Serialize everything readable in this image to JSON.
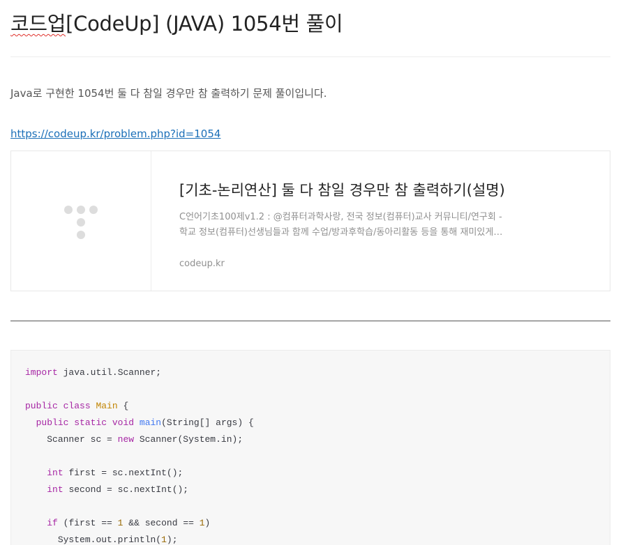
{
  "post": {
    "title_prefix": "코드업",
    "title_rest": "[CodeUp] (JAVA) 1054번 풀이",
    "intro": "Java로 구현한 1054번 둘 다 참일 경우만 참 출력하기 문제 풀이입니다.",
    "link": "https://codeup.kr/problem.php?id=1054"
  },
  "og_card": {
    "title": "[기초-논리연산] 둘 다 참일 경우만 참 출력하기(설명)",
    "description": "C언어기초100제v1.2 : @컴퓨터과학사랑, 전국 정보(컴퓨터)교사 커뮤니티/연구회 - 학교 정보(컴퓨터)선생님들과 함께 수업/방과후학습/동아리활동 등을 통해 재미있게 배워보세요",
    "host": "codeup.kr",
    "thumb_icon": "placeholder-dots-icon"
  },
  "code": {
    "language": "java",
    "lines": [
      "import java.util.Scanner;",
      "",
      "public class Main {",
      "  public static void main(String[] args) {",
      "    Scanner sc = new Scanner(System.in);",
      "",
      "    int first = sc.nextInt();",
      "    int second = sc.nextInt();",
      "",
      "    if (first == 1 && second == 1)",
      "      System.out.println(1);"
    ]
  },
  "colors": {
    "link": "#1b6fb8",
    "keyword": "#a626a4",
    "class_name": "#c18401",
    "function": "#4078f2",
    "number": "#986801",
    "code_background": "#f7f7f7"
  }
}
